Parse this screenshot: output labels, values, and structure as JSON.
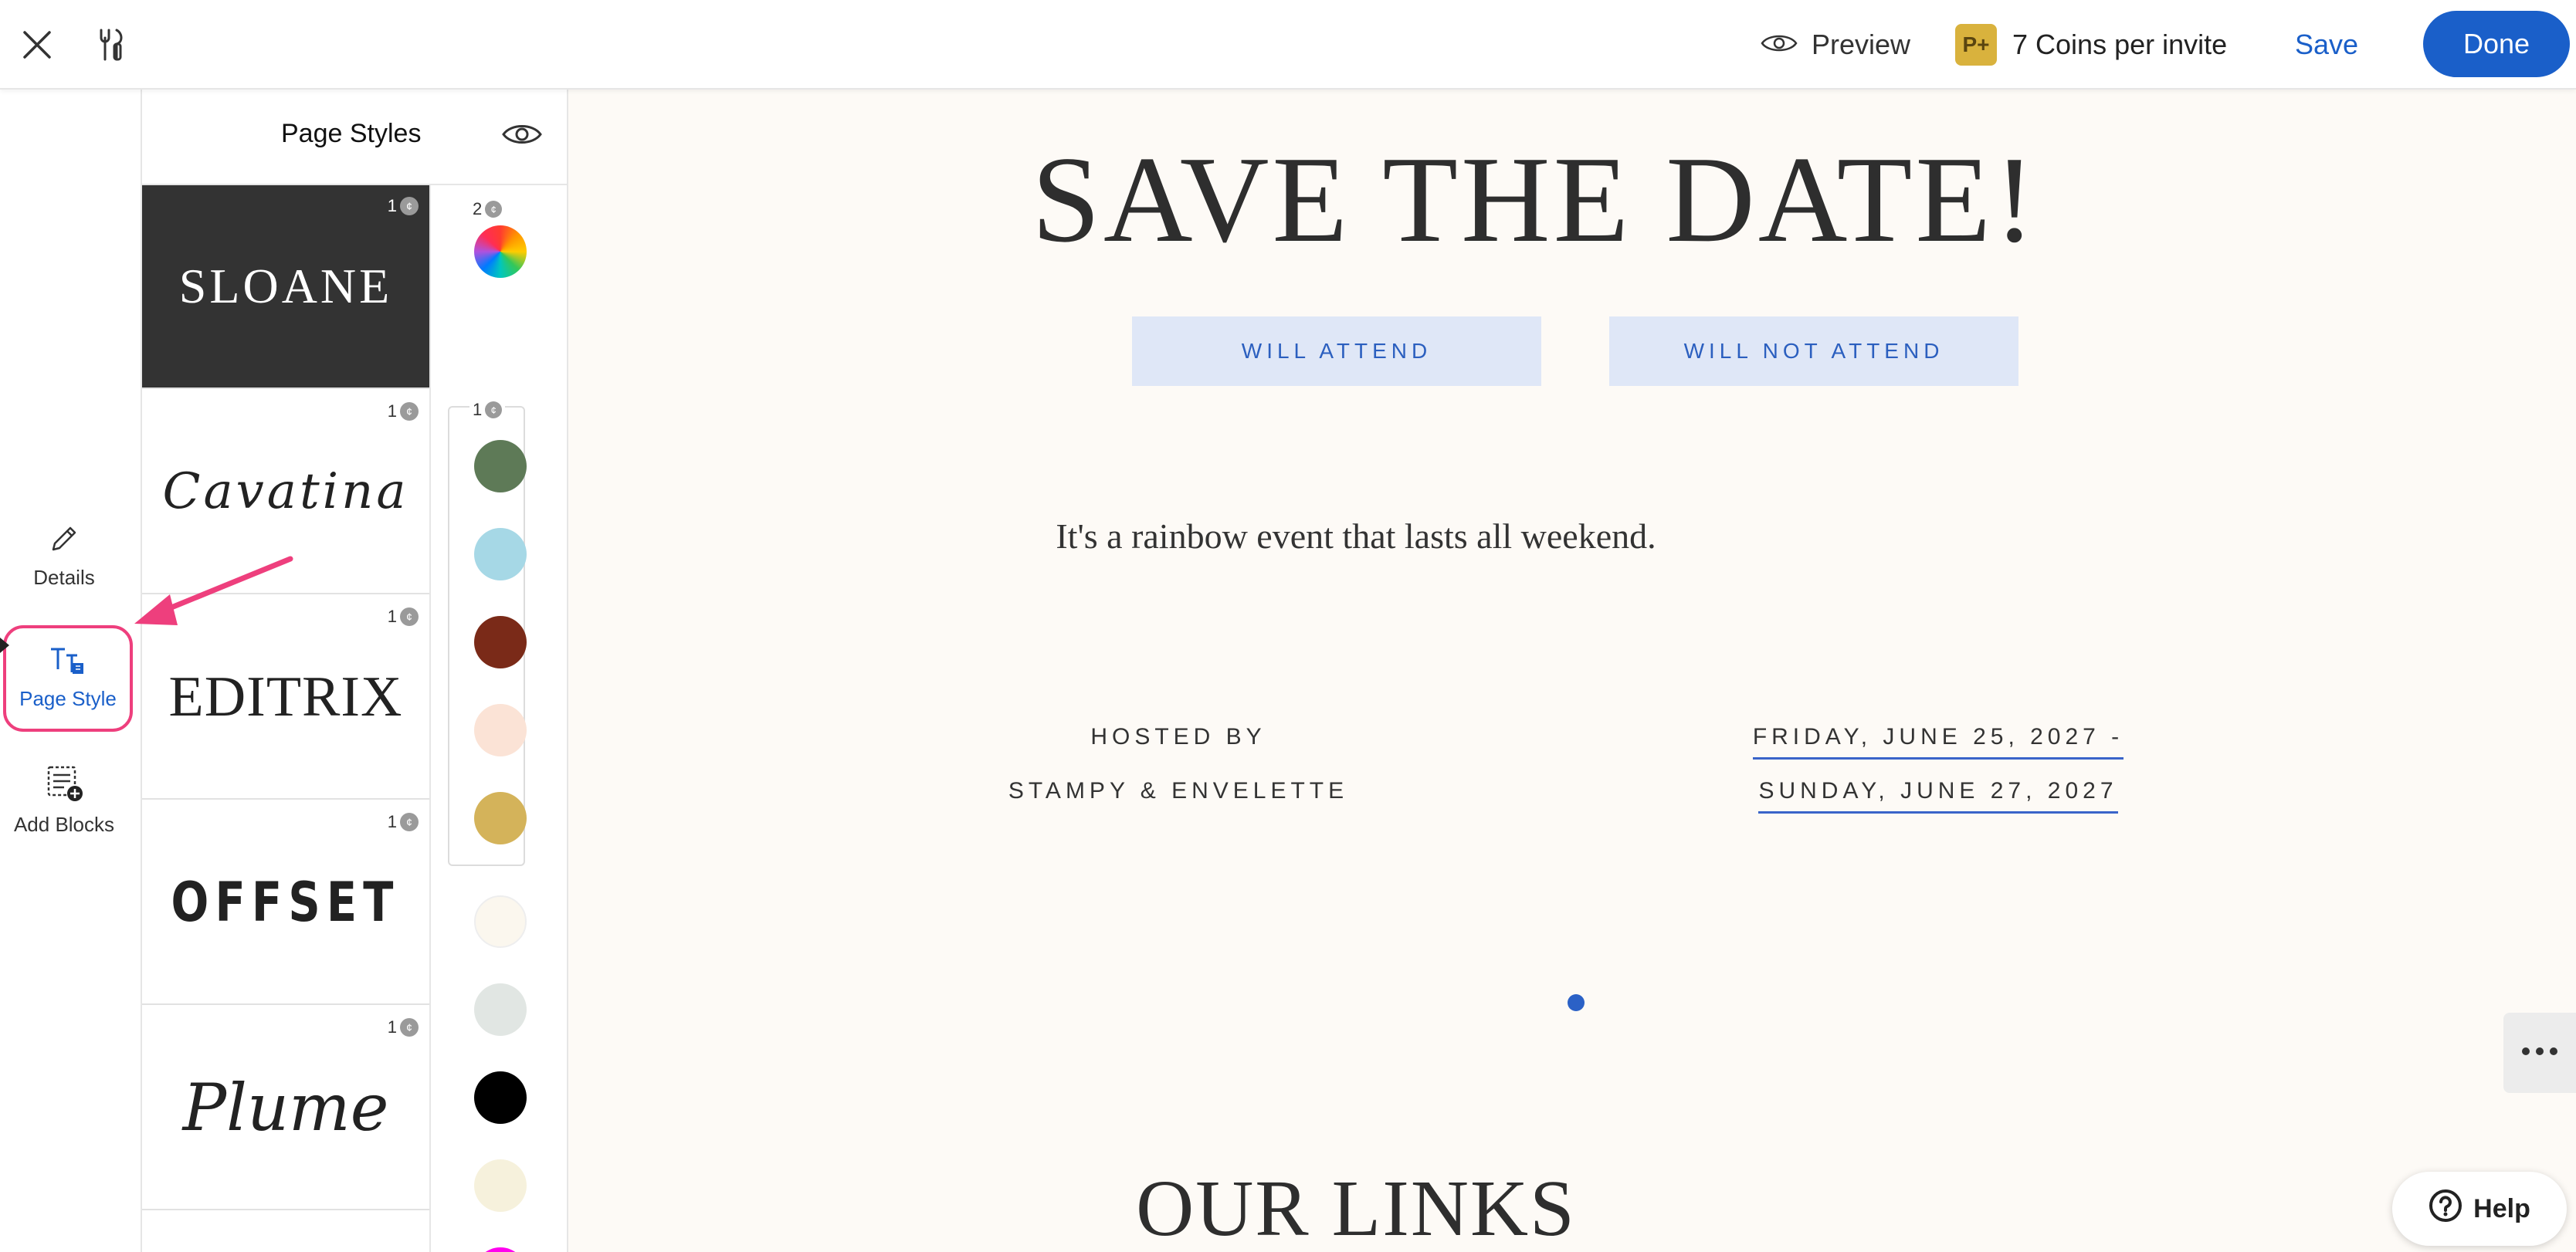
{
  "topbar": {
    "preview_label": "Preview",
    "coin_badge": "P+",
    "coins_label": "7 Coins per invite",
    "save_label": "Save",
    "done_label": "Done"
  },
  "rail": {
    "items": [
      {
        "label": "Details",
        "icon": "pencil-icon"
      },
      {
        "label": "Page Style",
        "icon": "page-style-icon",
        "active": true
      },
      {
        "label": "Add Blocks",
        "icon": "add-blocks-icon"
      }
    ]
  },
  "panel": {
    "title": "Page Styles",
    "fonts": [
      {
        "name": "SLOANE",
        "cost": "1"
      },
      {
        "name": "Cavatina",
        "cost": "1"
      },
      {
        "name": "EDITRIX",
        "cost": "1"
      },
      {
        "name": "OFFSET",
        "cost": "1"
      },
      {
        "name": "Plume",
        "cost": "1"
      }
    ],
    "rainbow_cost": "2",
    "group_cost": "1",
    "colors": [
      "#5e7a57",
      "#a6d8e6",
      "#7a2a18",
      "#fbe3d6",
      "#d4b35a",
      "#fbf7ee",
      "#e1e6e3",
      "#000000",
      "#f6f1dc",
      "#ff00ee"
    ]
  },
  "canvas": {
    "headline": "SAVE THE DATE!",
    "rsvp_yes": "WILL ATTEND",
    "rsvp_no": "WILL NOT ATTEND",
    "tagline": "It's a rainbow event that lasts all weekend.",
    "hosted_by_label": "HOSTED BY",
    "hosts": "STAMPY & ENVELETTE",
    "date_line1": "FRIDAY, JUNE 25, 2027 -",
    "date_line2": "SUNDAY, JUNE 27, 2027",
    "links_title": "OUR LINKS",
    "help_label": "Help"
  },
  "colors": {
    "accent": "#1a5fc9",
    "highlight": "#ee3f7d",
    "canvas_bg": "#fdfaf6",
    "rsvp_bg": "#dfe7f7"
  }
}
